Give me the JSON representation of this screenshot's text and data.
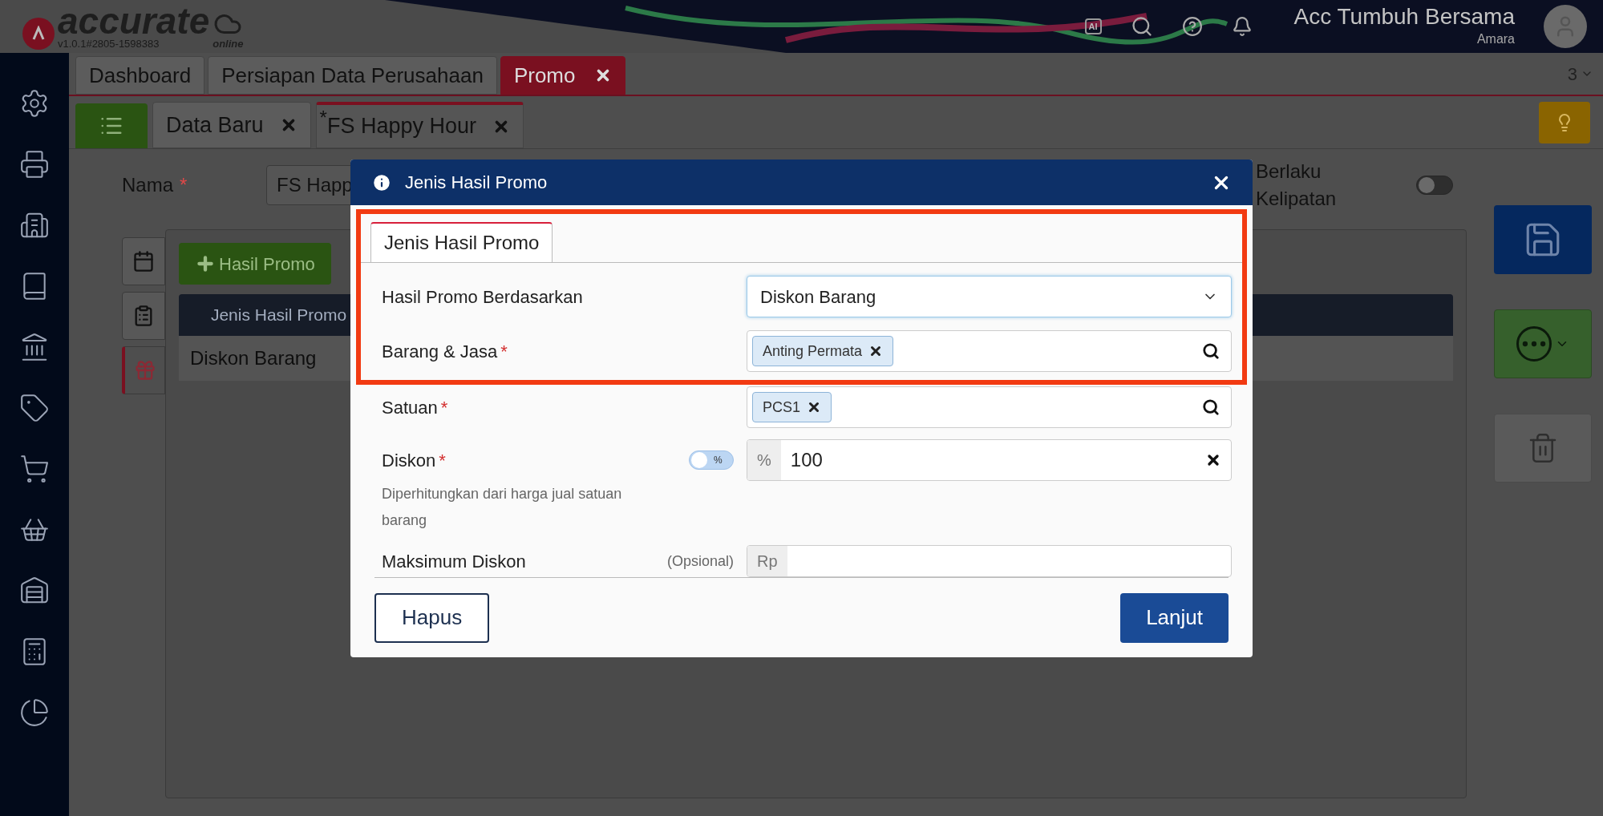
{
  "header": {
    "logo": "accurate",
    "logo_sub": "online",
    "version": "v1.0.1#2805-1598383",
    "ai_badge": "AI",
    "company": "Acc Tumbuh Bersama",
    "user": "Amara"
  },
  "top_tabs": [
    {
      "label": "Dashboard",
      "selected": false,
      "closable": false
    },
    {
      "label": "Persiapan Data Perusahaan",
      "selected": false,
      "closable": false
    },
    {
      "label": "Promo",
      "selected": true,
      "closable": true
    }
  ],
  "tab_count": "3",
  "sub_tabs": [
    {
      "label": "Data Baru",
      "selected": false
    },
    {
      "label": "FS Happy Hour",
      "selected": true,
      "mark": "*"
    }
  ],
  "form": {
    "name_label": "Nama",
    "name_required": true,
    "name_value": "FS Happ",
    "multiple_label": "Berlaku Kelipatan",
    "multiple_on": false
  },
  "side_tabs": [
    {
      "kind": "calendar",
      "selected": false
    },
    {
      "kind": "checklist",
      "selected": false
    },
    {
      "kind": "gift",
      "selected": true
    }
  ],
  "add_button": "Hasil Promo",
  "table": {
    "columns": [
      "Jenis Hasil Promo"
    ],
    "rows": [
      [
        "Diskon Barang"
      ]
    ]
  },
  "modal": {
    "title": "Jenis Hasil Promo",
    "highlight_box": {
      "tab": "Jenis Hasil Promo",
      "fields": [
        {
          "kind": "select",
          "label": "Hasil Promo Berdasarkan",
          "required": false,
          "value": "Diskon Barang"
        },
        {
          "kind": "tags",
          "label": "Barang & Jasa",
          "required": true,
          "tags": [
            "Anting Permata"
          ]
        }
      ]
    },
    "fields": [
      {
        "kind": "tags",
        "label": "Satuan",
        "required": true,
        "tags": [
          "PCS1"
        ]
      },
      {
        "kind": "number",
        "label": "Diskon",
        "required": true,
        "hint": "Diperhitungkan dari harga jual satuan barang",
        "toggle_label": "%",
        "toggle_on": false,
        "prefix": "%",
        "value": "100"
      },
      {
        "kind": "number",
        "label": "Maksimum Diskon",
        "required": false,
        "optional": "(Opsional)",
        "prefix": "Rp"
      }
    ],
    "buttons": [
      {
        "kind": "secondary",
        "label": "Hapus"
      },
      {
        "kind": "primary",
        "label": "Lanjut"
      }
    ]
  }
}
